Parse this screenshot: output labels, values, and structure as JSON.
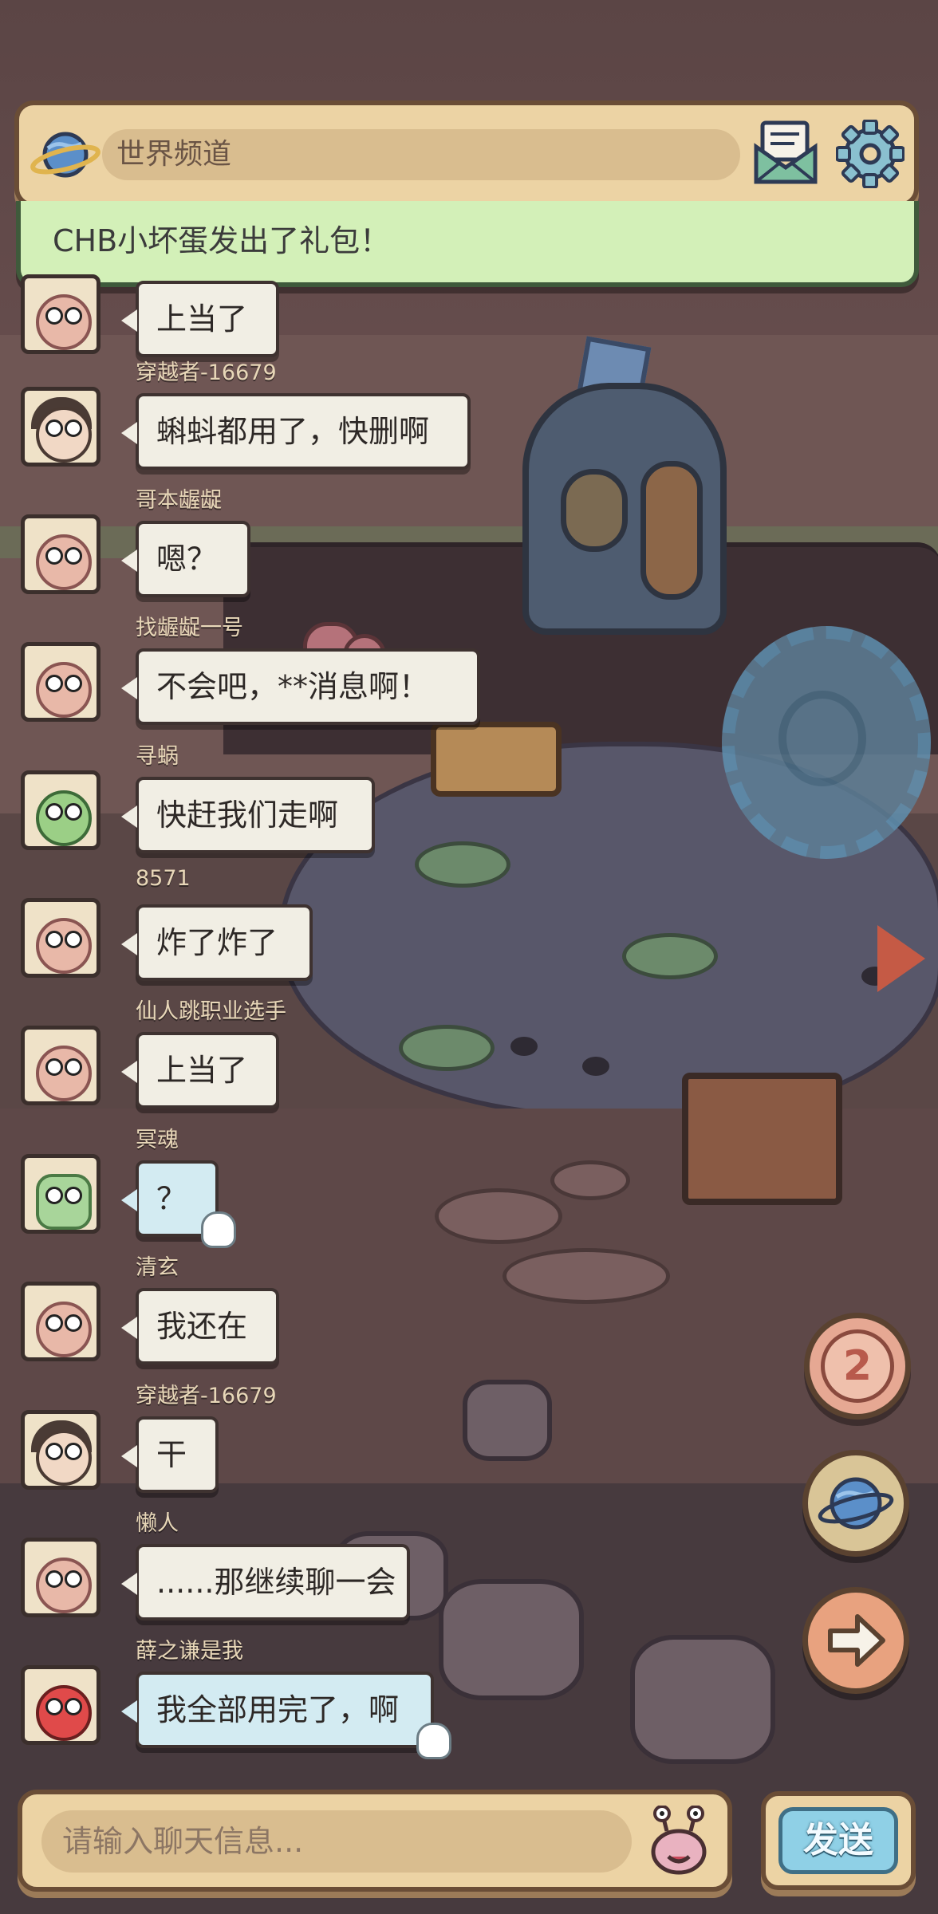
{
  "header": {
    "channel_label": "世界频道",
    "icons": [
      "planet-icon",
      "mail-icon",
      "gear-icon"
    ]
  },
  "announcement": "CHB小坏蛋发出了礼包！",
  "messages": [
    {
      "sender": "",
      "text": "上当了",
      "avatar": "snail",
      "bubble": "white"
    },
    {
      "sender": "穿越者-16679",
      "text": "蝌蚪都用了，快删啊",
      "avatar": "girl",
      "bubble": "white"
    },
    {
      "sender": "哥本龌龊",
      "text": "嗯？",
      "avatar": "snail",
      "bubble": "white"
    },
    {
      "sender": "找龌龊一号",
      "text": "不会吧，**消息啊！",
      "avatar": "snail",
      "bubble": "white"
    },
    {
      "sender": "寻蜗",
      "text": "快赶我们走啊",
      "avatar": "green",
      "bubble": "white"
    },
    {
      "sender": "8571",
      "text": "炸了炸了",
      "avatar": "snail",
      "bubble": "white"
    },
    {
      "sender": "仙人跳职业选手",
      "text": "上当了",
      "avatar": "snail",
      "bubble": "white"
    },
    {
      "sender": "冥魂",
      "text": "？",
      "avatar": "cactus",
      "bubble": "blue"
    },
    {
      "sender": "清玄",
      "text": "我还在",
      "avatar": "snail",
      "bubble": "white"
    },
    {
      "sender": "穿越者-16679",
      "text": "干",
      "avatar": "girl",
      "bubble": "white"
    },
    {
      "sender": "懒人",
      "text": "......那继续聊一会",
      "avatar": "snail",
      "bubble": "white"
    },
    {
      "sender": "薛之谦是我",
      "text": "我全部用完了，啊",
      "avatar": "red",
      "bubble": "blue"
    }
  ],
  "side_buttons": {
    "count": "2"
  },
  "input": {
    "placeholder": "请输入聊天信息..."
  },
  "send_label": "发送",
  "colors": {
    "panel": "#ecd3a4",
    "panel_border": "#6a4d36",
    "announce_bg": "#d3f0b8",
    "send_button": "#8fd0e6",
    "bubble_white": "#f1eee4",
    "bubble_blue": "#d3ebf2"
  }
}
